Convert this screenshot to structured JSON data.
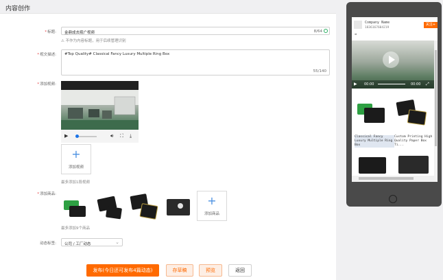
{
  "header": {
    "title": "内容创作"
  },
  "form": {
    "title": {
      "label": "标题:",
      "value": "金鼎成去瓶广视频",
      "count": "8/64",
      "hint": "⚠ 不作为内容标题，用于后续管理识别"
    },
    "description": {
      "label": "视文描述:",
      "value": "#Top Quality# Classical Fancy Luxury Multiple Ring Box",
      "count": "55/140"
    },
    "video": {
      "label": "添加视频:",
      "add_label": "添加视频",
      "hint": "最多添加1段视频"
    },
    "products": {
      "label": "添加商品:",
      "add_label": "添加商品",
      "hint": "最多添加9个商品"
    },
    "tag": {
      "label": "动态标签:",
      "value": "公司 / 工厂动态"
    }
  },
  "buttons": {
    "publish": "发布(今日还可发布4篇动态)",
    "save_draft": "存草稿",
    "preview": "预览",
    "back": "返回"
  },
  "preview": {
    "company_name": "Company Name",
    "company_id": "1836167604219",
    "follow_label": "关注+",
    "quote": "❝",
    "time_current": "00:00",
    "time_total": "00:00",
    "captions": [
      "Classical Fancy Luxury Multiple Ring Box",
      "Custom Printing High Quality Paper Box Ti..."
    ]
  },
  "colors": {
    "accent": "#ff6a00",
    "required": "#e4393c",
    "link": "#4a90e2"
  }
}
